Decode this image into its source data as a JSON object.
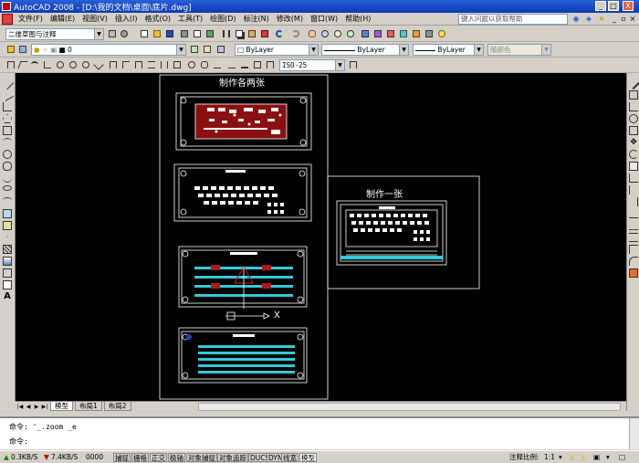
{
  "window": {
    "title": "AutoCAD 2008 - [D:\\我的文档\\桌面\\底片.dwg]",
    "controls": [
      "_",
      "□",
      "X"
    ]
  },
  "menus": [
    "文件(F)",
    "编辑(E)",
    "视图(V)",
    "插入(I)",
    "格式(O)",
    "工具(T)",
    "绘图(D)",
    "标注(N)",
    "修改(M)",
    "窗口(W)",
    "帮助(H)"
  ],
  "search": {
    "placeholder": "键入问题以获取帮助"
  },
  "workspace": {
    "value": "二维草图与注释"
  },
  "layer": {
    "value": "0"
  },
  "props": {
    "color": "ByLayer",
    "linetype": "ByLayer",
    "lineweight": "ByLayer",
    "plotstyle": "随颜色"
  },
  "dimstyle": {
    "value": "ISO-25"
  },
  "drawing": {
    "label_two": "制作各两张",
    "label_one": "制作一张",
    "axis_x": "X"
  },
  "tabs": {
    "model": "模型",
    "layout1": "布局1",
    "layout2": "布局2"
  },
  "command": {
    "history": "命令: '_.zoom _e",
    "prompt": "命令:"
  },
  "status": {
    "net_up": "0.3KB/S",
    "net_down": "7.4KB/S",
    "coords": "0000",
    "toggles": [
      "捕捉",
      "栅格",
      "正交",
      "极轴",
      "对象捕捉",
      "对象追踪",
      "DUCS",
      "DYN",
      "线宽",
      "模型"
    ],
    "scale_label": "注释比例:",
    "scale_value": "1:1"
  },
  "colors": {
    "accent": "#0a3ab4",
    "canvas": "#000000",
    "red_fill": "#b01818",
    "cyan": "#33c9d9"
  }
}
